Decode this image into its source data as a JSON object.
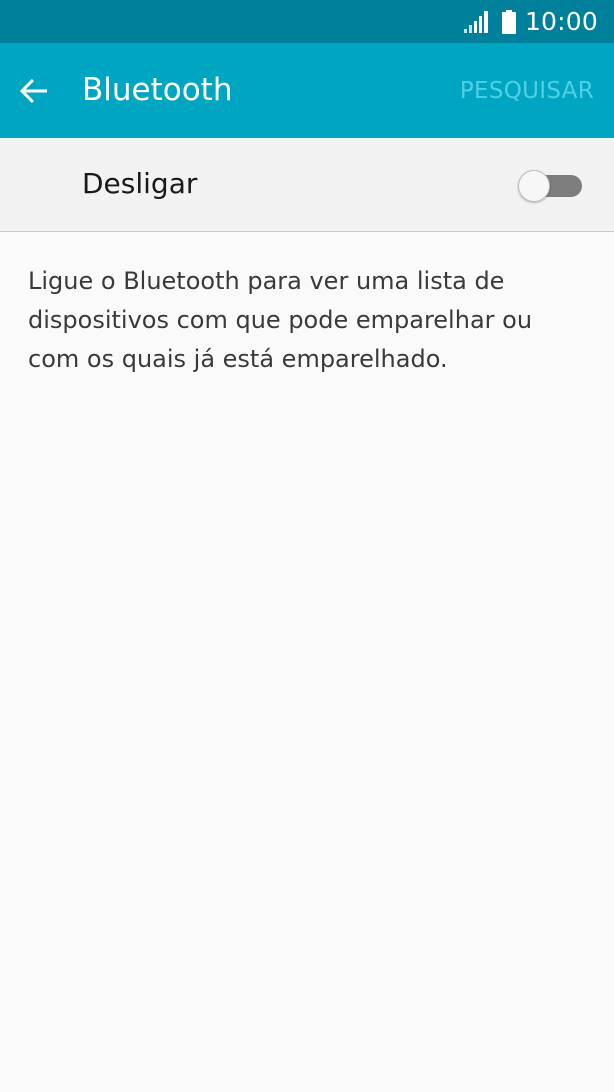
{
  "status_bar": {
    "time": "10:00",
    "signal_icon": "signal-icon",
    "battery_icon": "battery-icon"
  },
  "app_bar": {
    "title": "Bluetooth",
    "back_icon": "arrow-left-icon",
    "action_label": "PESQUISAR",
    "background_color": "#00a5c2"
  },
  "bluetooth_toggle": {
    "label": "Desligar",
    "state": "off"
  },
  "description": "Ligue o Bluetooth para ver uma lista de dispositivos com que pode emparelhar ou com os quais já está emparelhado.",
  "colors": {
    "status_bar": "#00809a",
    "app_bar": "#00a5c2",
    "action_disabled": "#4fd0e5",
    "background": "#fafafa"
  }
}
